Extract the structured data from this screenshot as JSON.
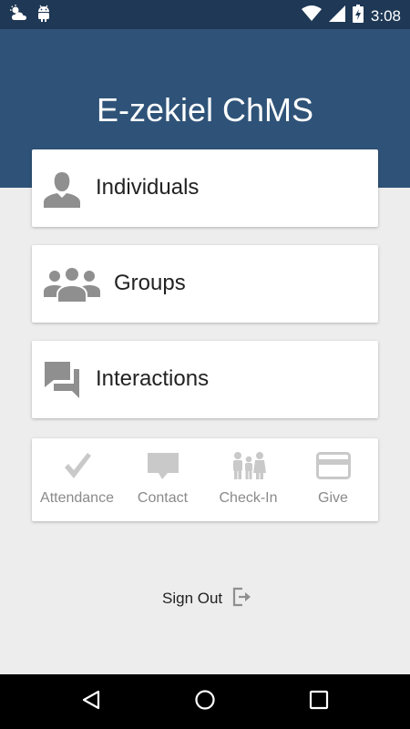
{
  "status_bar": {
    "time": "3:08",
    "left_icons": [
      "weather-icon",
      "android-icon"
    ],
    "right_icons": [
      "wifi-icon",
      "signal-icon",
      "battery-charging-icon"
    ]
  },
  "app": {
    "title": "E-zekiel ChMS"
  },
  "menu": [
    {
      "label": "Individuals",
      "icon": "person-icon"
    },
    {
      "label": "Groups",
      "icon": "group-icon"
    },
    {
      "label": "Interactions",
      "icon": "chat-icon"
    }
  ],
  "quick_actions": [
    {
      "label": "Attendance",
      "icon": "checkmark-icon"
    },
    {
      "label": "Contact",
      "icon": "message-icon"
    },
    {
      "label": "Check-In",
      "icon": "family-icon"
    },
    {
      "label": "Give",
      "icon": "credit-card-icon"
    }
  ],
  "sign_out": {
    "label": "Sign Out",
    "icon": "exit-icon"
  },
  "colors": {
    "status_bar": "#1e3855",
    "header": "#2f5378",
    "background": "#ededed",
    "card": "#ffffff",
    "icon_gray": "#8f8f8f",
    "quick_icon_gray": "#c9c9c9"
  }
}
